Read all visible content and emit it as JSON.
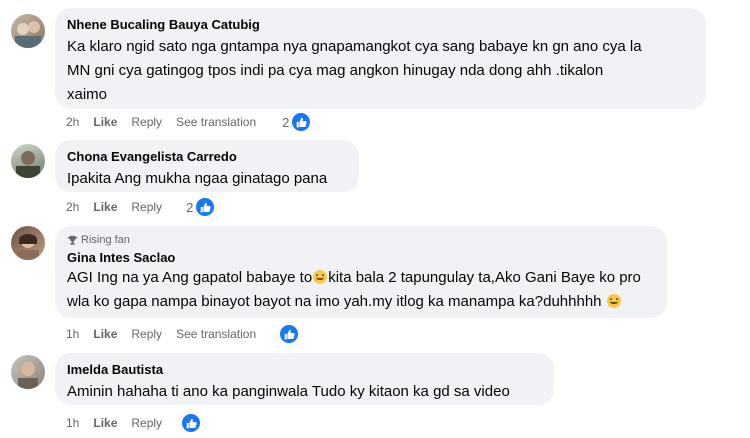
{
  "comments": [
    {
      "author": "Nhene Bucaling Bauya Catubig",
      "text_lines": [
        "Ka klaro ngid sato nga gntampa nya gnapamangkot cya sang babaye kn gn ano cya la",
        "MN gni cya gatingog tpos indi pa cya mag angkon hinugay nda dong ahh .tikalon",
        "xaimo"
      ],
      "time": "2h",
      "like_label": "Like",
      "reply_label": "Reply",
      "translation_label": "See translation",
      "reaction_count": "2"
    },
    {
      "author": "Chona Evangelista Carredo",
      "text_lines": [
        "Ipakita Ang mukha ngaa ginatago pana"
      ],
      "time": "2h",
      "like_label": "Like",
      "reply_label": "Reply",
      "reaction_count": "2"
    },
    {
      "badge": "Rising fan",
      "author": "Gina Intes Saclao",
      "text_line1_a": "AGI Ing na ya Ang gapatol babaye to",
      "text_line1_b": "kita bala 2 tapungulay ta,Ako Gani Baye ko pro",
      "text_line2": "wla ko gapa nampa binayot bayot na imo yah.my itlog ka manampa ka?duhhhhh",
      "time": "1h",
      "like_label": "Like",
      "reply_label": "Reply",
      "translation_label": "See translation",
      "reaction_count": ""
    },
    {
      "author": "Imelda Bautista",
      "text_lines": [
        "Aminin hahaha ti ano ka panginwala Tudo ky kitaon ka gd sa video"
      ],
      "time": "1h",
      "like_label": "Like",
      "reply_label": "Reply",
      "reaction_count": ""
    }
  ],
  "colors": {
    "bubble": "#f0f2f5",
    "meta": "#65676b",
    "like_blue": "#1877f2"
  },
  "icons": {
    "like": "thumbs-up-icon",
    "rising_fan": "trophy-icon",
    "emoji": "grinning-face-icon"
  }
}
